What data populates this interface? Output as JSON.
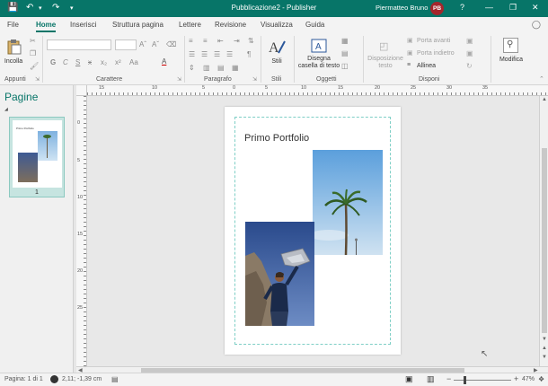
{
  "titlebar": {
    "title": "Pubblicazione2 - Publisher",
    "user_name": "Piermatteo Bruno",
    "user_initials": "PB",
    "bg_color": "#077568"
  },
  "tabs": [
    "File",
    "Home",
    "Inserisci",
    "Struttura pagina",
    "Lettere",
    "Revisione",
    "Visualizza",
    "Guida"
  ],
  "active_tab": "Home",
  "ribbon": {
    "clipboard": {
      "paste_label": "Incolla",
      "group_label": "Appunti"
    },
    "font": {
      "group_label": "Carattere",
      "bold": "G",
      "italic": "C",
      "underline": "S",
      "strike": "x",
      "subscript": "x₂",
      "superscript": "x²",
      "case": "Aa",
      "color": "A"
    },
    "paragraph": {
      "group_label": "Paragrafo"
    },
    "styles": {
      "label": "Stili",
      "group_label": "Stili"
    },
    "objects": {
      "draw_textbox_label": "Disegna\ncasella di testo",
      "group_label": "Oggetti"
    },
    "arrange": {
      "text_wrap_label": "Disposizione\ntesto",
      "bring_forward": "Porta avanti",
      "send_backward": "Porta indietro",
      "align": "Allinea",
      "group_label": "Disponi"
    },
    "editing": {
      "label": "Modifica"
    }
  },
  "pages_pane": {
    "title": "Pagine",
    "thumbnail_text": "Primo Portfolio",
    "page_number": "1",
    "selected_color": "#c6e4e0"
  },
  "ruler": {
    "top_labels": [
      "15",
      "10",
      "5",
      "0",
      "5",
      "10",
      "15",
      "20",
      "25",
      "30",
      "35"
    ],
    "left_labels": [
      "0",
      "5",
      "10",
      "15",
      "20",
      "25"
    ]
  },
  "document": {
    "title": "Primo Portfolio",
    "guide_color": "#7fcfc6"
  },
  "statusbar": {
    "page_info": "Pagina: 1 di 1",
    "coords": "2,11; -1,39 cm",
    "zoom": "47%"
  }
}
